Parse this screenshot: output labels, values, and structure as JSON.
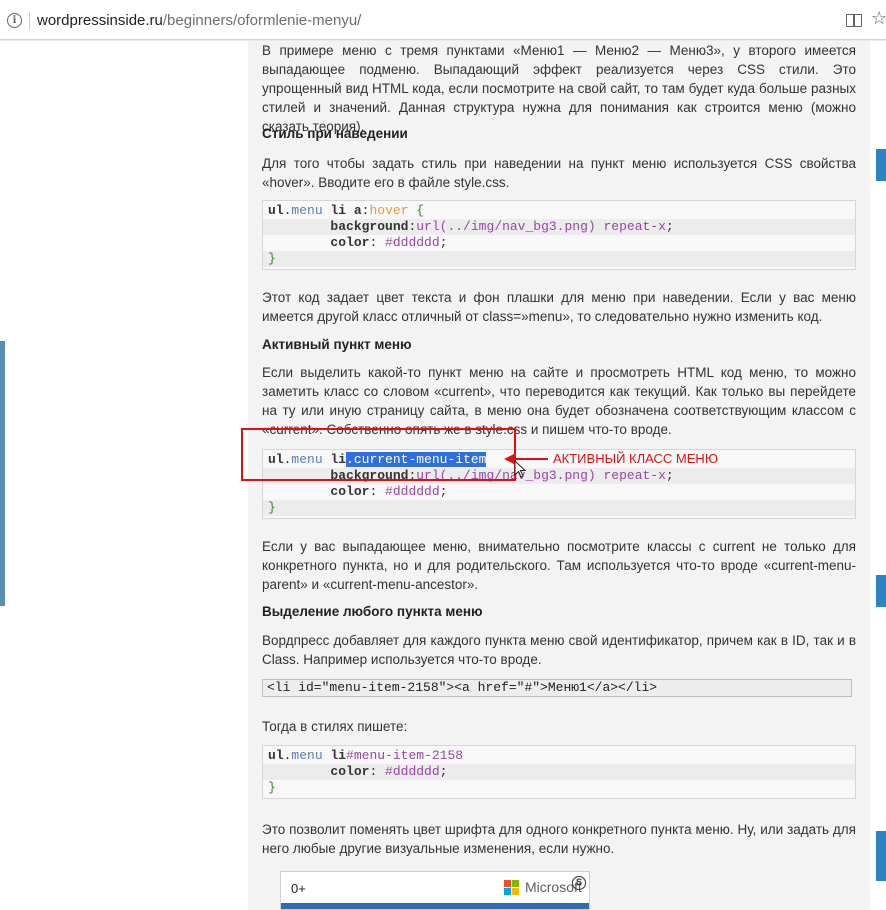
{
  "browser": {
    "url_host": "wordpressinside.ru",
    "url_path": "/beginners/oformlenie-menyu/"
  },
  "article": {
    "intro": "В примере меню с тремя пунктами «Меню1 — Меню2 — Меню3», у второго имеется выпадающее подменю. Выпадающий эффект реализуется через CSS стили. Это упрощенный вид HTML кода, если посмотрите на свой сайт, то там будет куда больше разных стилей и значений. Данная структура нужна для понимания как строится меню (можно сказать теория).",
    "hover_heading": "Стиль при наведении",
    "hover_text": "Для того чтобы задать стиль при наведении на пункт меню используется CSS свойства «hover». Вводите его в файле style.css.",
    "hover_note": "Этот код задает цвет текста и фон плашки для меню при наведении. Если у вас меню имеется другой класс отличный от class=»menu», то следовательно нужно изменить код.",
    "active_heading": "Активный пункт меню",
    "active_text": "Если выделить какой-то пункт меню на сайте и просмотреть HTML код меню, то можно заметить класс со словом «current», что переводится как текущий. Как только вы перейдете на ту или иную страницу сайта, в меню она будет обозначена соответствующим классом с «current». Собственно опять же в style.css и пишем что-то вроде.",
    "dropdown_text": "Если у вас выпадающее меню, внимательно посмотрите классы с current не только для конкретного пункта, но и для родительского. Там используется что-то вроде «current-menu-parent» и «current-menu-ancestor».",
    "any_heading": "Выделение любого пункта меню",
    "any_text": "Вордпресс добавляет для каждого пункта меню свой идентификатор, причем как в ID, так и в Class. Например используется что-то вроде.",
    "inline_code": "<li id=\"menu-item-2158\"><a href=\"#\">Меню1</a></li>",
    "then_text": "Тогда в стилях пишете:",
    "final_text": "Это позволит поменять цвет шрифта для одного конкретного пункта меню. Ну, или задать для него любые другие визуальные изменения, если нужно."
  },
  "code": {
    "ul": "ul",
    "dot": ".",
    "menu": "menu",
    "li": " li ",
    "li_plain": " li",
    "a": "a",
    "colon": ":",
    "hover": "hover",
    "open": " {",
    "indent": "        ",
    "background": "background",
    "url_val": "url(../img/nav_bg3.png)",
    "repeat": " repeat-x",
    "semi": ";",
    "color": "color",
    "color_val": " #dddddd",
    "close": "}",
    "current_class": ".current-menu-item",
    "hash_id": "#menu-item-2158"
  },
  "annotation": {
    "label": "АКТИВНЫЙ КЛАСС МЕНЮ",
    "color": "#e01010"
  },
  "thumbnail": {
    "text": "0+",
    "brand": "Microsoft",
    "badge": "S"
  },
  "colors": {
    "accent_blue": "#2d84c4",
    "selection": "#2f6fe0",
    "code_value": "#9a45a5"
  }
}
